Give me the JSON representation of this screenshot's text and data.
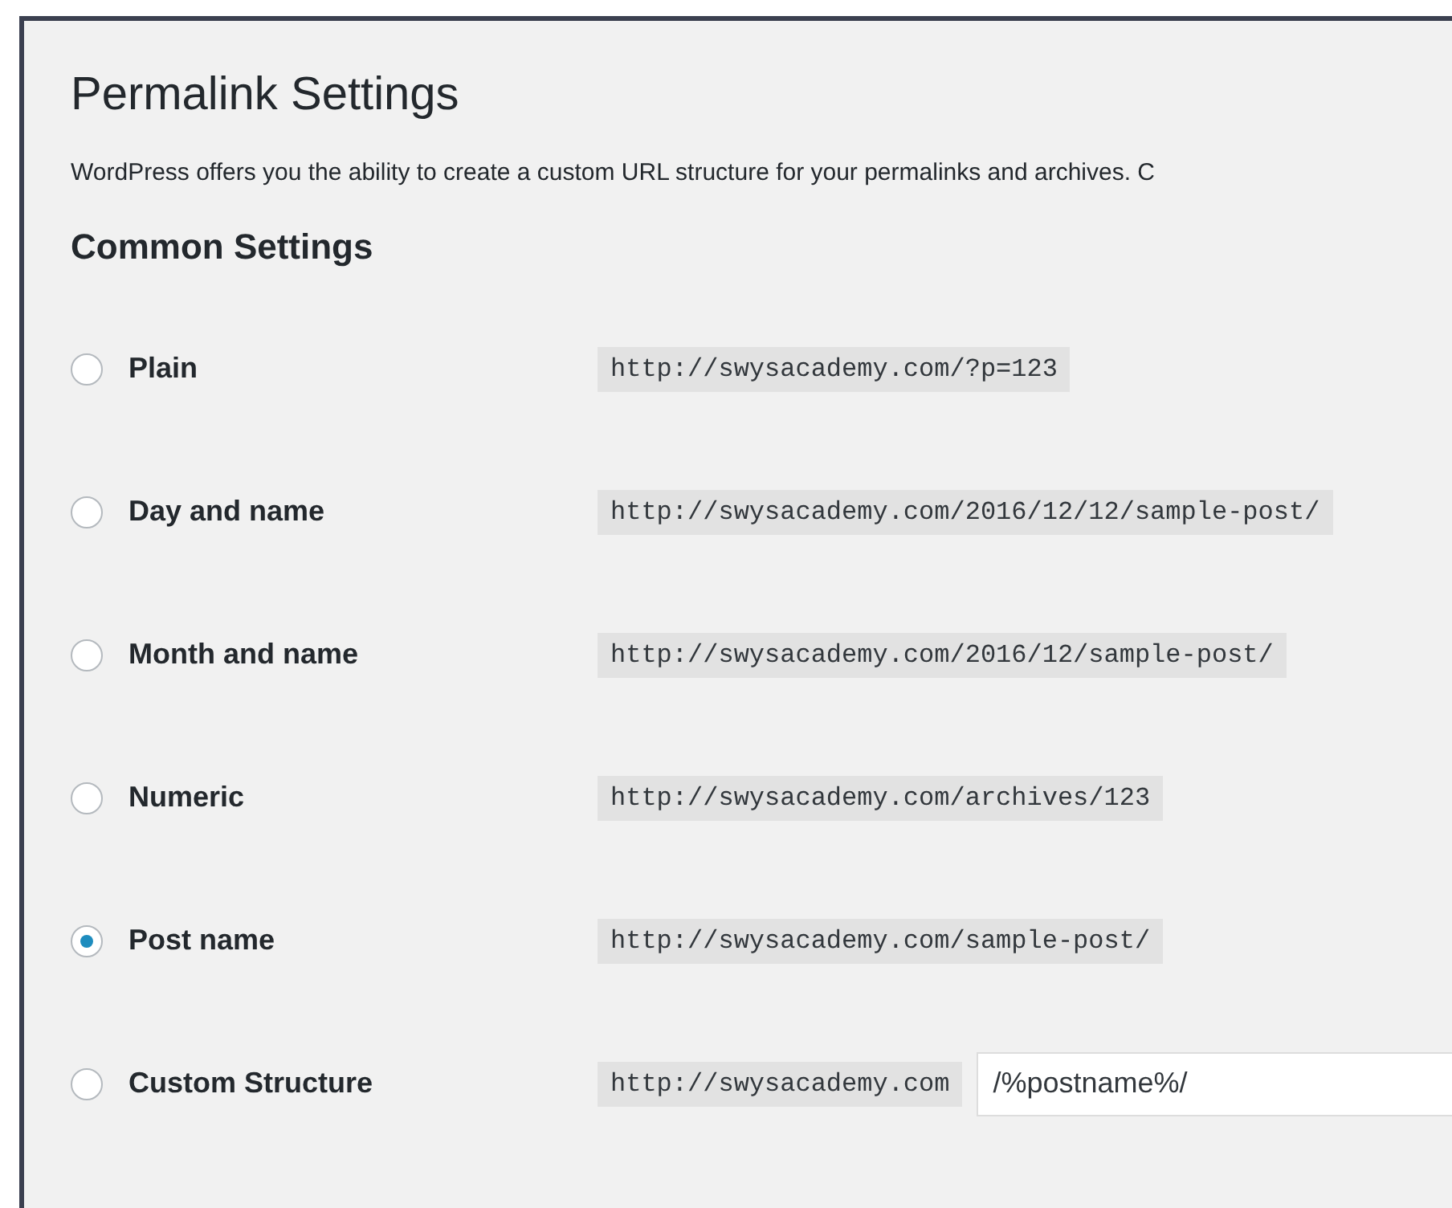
{
  "title": "Permalink Settings",
  "description": "WordPress offers you the ability to create a custom URL structure for your permalinks and archives. C",
  "section_title": "Common Settings",
  "options": [
    {
      "label": "Plain",
      "selected": false,
      "example": "http://swysacademy.com/?p=123"
    },
    {
      "label": "Day and name",
      "selected": false,
      "example": "http://swysacademy.com/2016/12/12/sample-post/"
    },
    {
      "label": "Month and name",
      "selected": false,
      "example": "http://swysacademy.com/2016/12/sample-post/"
    },
    {
      "label": "Numeric",
      "selected": false,
      "example": "http://swysacademy.com/archives/123"
    },
    {
      "label": "Post name",
      "selected": true,
      "example": "http://swysacademy.com/sample-post/"
    },
    {
      "label": "Custom Structure",
      "selected": false,
      "example": "http://swysacademy.com",
      "value": "/%postname%/"
    }
  ]
}
